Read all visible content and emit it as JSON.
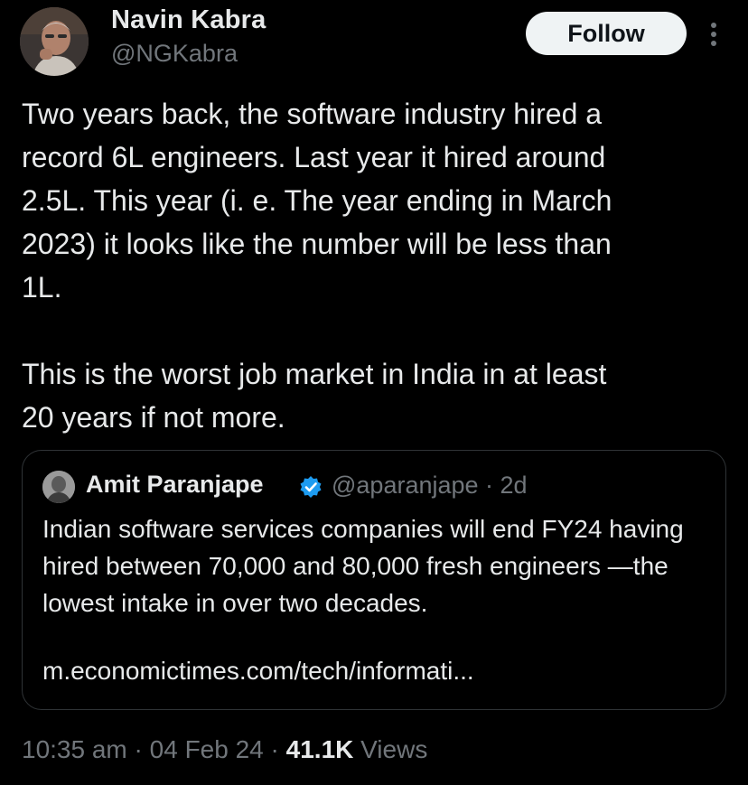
{
  "author": {
    "name": "Navin Kabra",
    "handle": "@NGKabra"
  },
  "follow_label": "Follow",
  "tweet": {
    "text": "Two years back, the software industry hired a\nrecord 6L engineers. Last year it hired around\n2.5L. This year (i. e. The year ending in March\n2023) it looks like the number will be less than\n1L.\n\nThis is the worst job market in India in at least\n20 years if not more."
  },
  "quote": {
    "name": "Amit Paranjape",
    "meta": "@aparanjape · 2d",
    "text": "Indian software services companies will end FY24 having hired between 70,000 and 80,000 fresh engineers —the lowest intake in over two decades.",
    "link": "m.economictimes.com/tech/informati..."
  },
  "footer": {
    "time": "10:35 am",
    "separator_1": " · ",
    "date": "04 Feb 24",
    "separator_2": " · ",
    "views_count": "41.1K",
    "views_label": " Views"
  },
  "colors": {
    "background": "#000000",
    "text": "#e7e9ea",
    "secondary_text": "#71767b",
    "follow_button": "#eff3f4",
    "verified": "#1d9bf0",
    "border": "#2f3336"
  },
  "icons": {
    "more": "more-vertical-icon",
    "verified": "verified-badge-icon"
  }
}
